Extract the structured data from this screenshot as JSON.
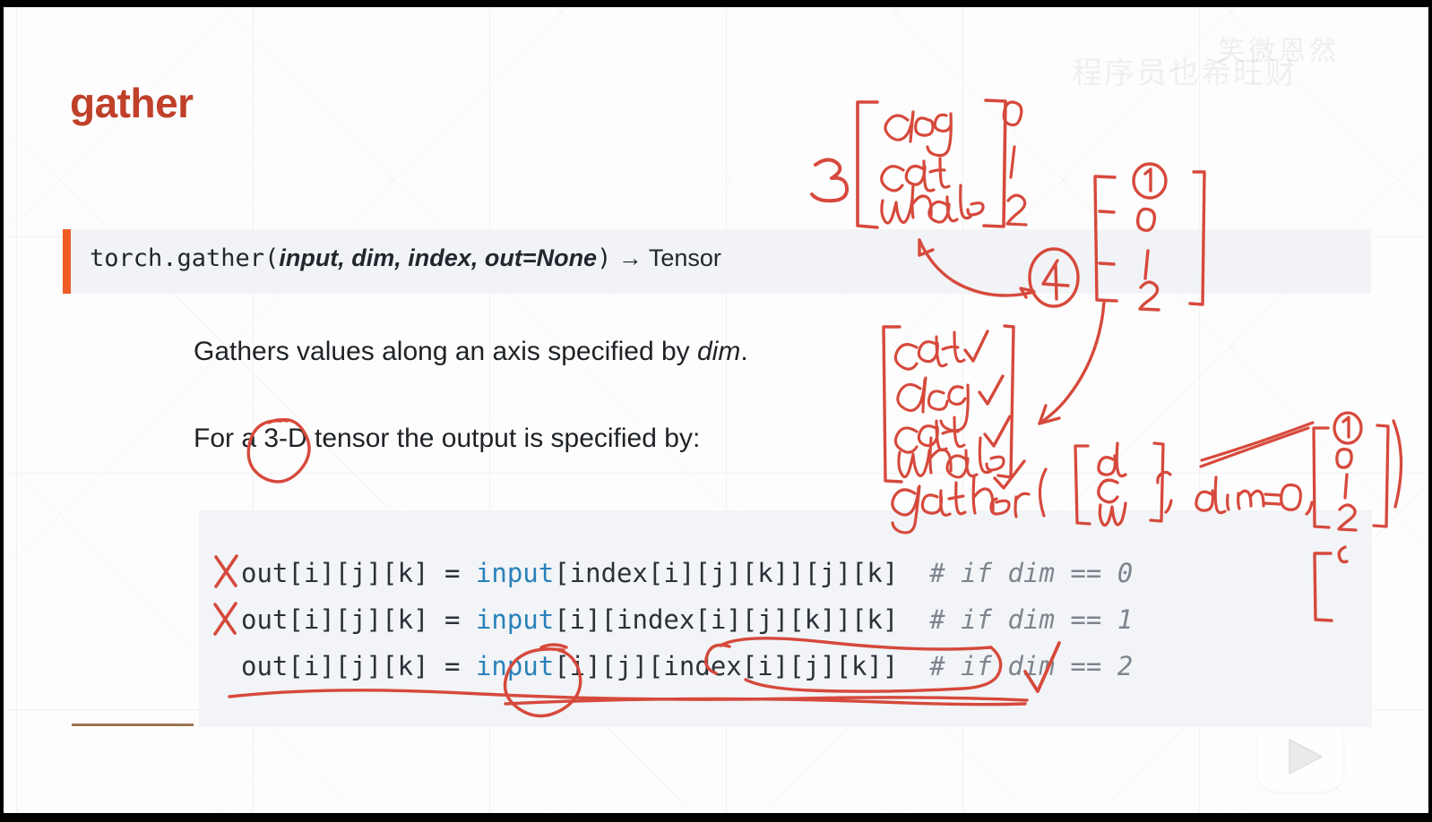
{
  "slide": {
    "title": "gather",
    "signature": {
      "prefix": "torch.gather(",
      "args": "input, dim, index, out=None",
      "suffix": ")",
      "arrow": " → ",
      "return_type": "Tensor",
      "accent_color": "#ef5b25",
      "background": "#f1f3f6"
    },
    "paragraphs": [
      {
        "text_before": "Gathers values along an axis specified by ",
        "emphasis": "dim",
        "text_after": "."
      },
      {
        "text_before": "For a 3-D tensor the output is specified by:",
        "emphasis": "",
        "text_after": ""
      }
    ],
    "code_block": {
      "background": "#f2f4f7",
      "keyword_color": "#2a81ba",
      "comment_color": "#7d858e",
      "lines": [
        {
          "lhs": "out[i][j][k] = ",
          "kw": "input",
          "rhs": "[index[i][j][k]][j][k]",
          "comment": "# if dim == 0"
        },
        {
          "lhs": "out[i][j][k] = ",
          "kw": "input",
          "rhs": "[i][index[i][j][k]][k]",
          "comment": "# if dim == 1"
        },
        {
          "lhs": "out[i][j][k] = ",
          "kw": "input",
          "rhs": "[i][j][index[i][j][k]]",
          "comment": "# if dim == 2"
        }
      ]
    },
    "title_color": "#c0402a",
    "body_color": "#1e2226"
  },
  "watermarks": {
    "text_primary": "程序员也希旺财",
    "text_secondary": "笑微恩然",
    "logo_name": "bilibili-tv-logo"
  },
  "annotations": {
    "ink_color": "#d6493c",
    "input_vector": {
      "count_label": "3",
      "items": [
        "dog",
        "cat",
        "whale"
      ],
      "indices": [
        "0",
        "1",
        "2"
      ]
    },
    "index_vector_top": {
      "items": [
        "1",
        "0",
        "1",
        "2"
      ],
      "circled_first": true
    },
    "output_vector": {
      "items": [
        "cat",
        "dog",
        "cat",
        "whale"
      ],
      "checkmarks": 4
    },
    "call_expression": {
      "func": "gather(",
      "arg_tensor": [
        "d",
        "c",
        "w"
      ],
      "dim_arg": "dim=0",
      "index_tensor": [
        "1",
        "0",
        "1",
        "2"
      ],
      "close": ")"
    },
    "circled_number": "4",
    "circled_text_in_paragraph": "3-D",
    "cross_marks": 2,
    "check_marks_on_code": 1
  }
}
